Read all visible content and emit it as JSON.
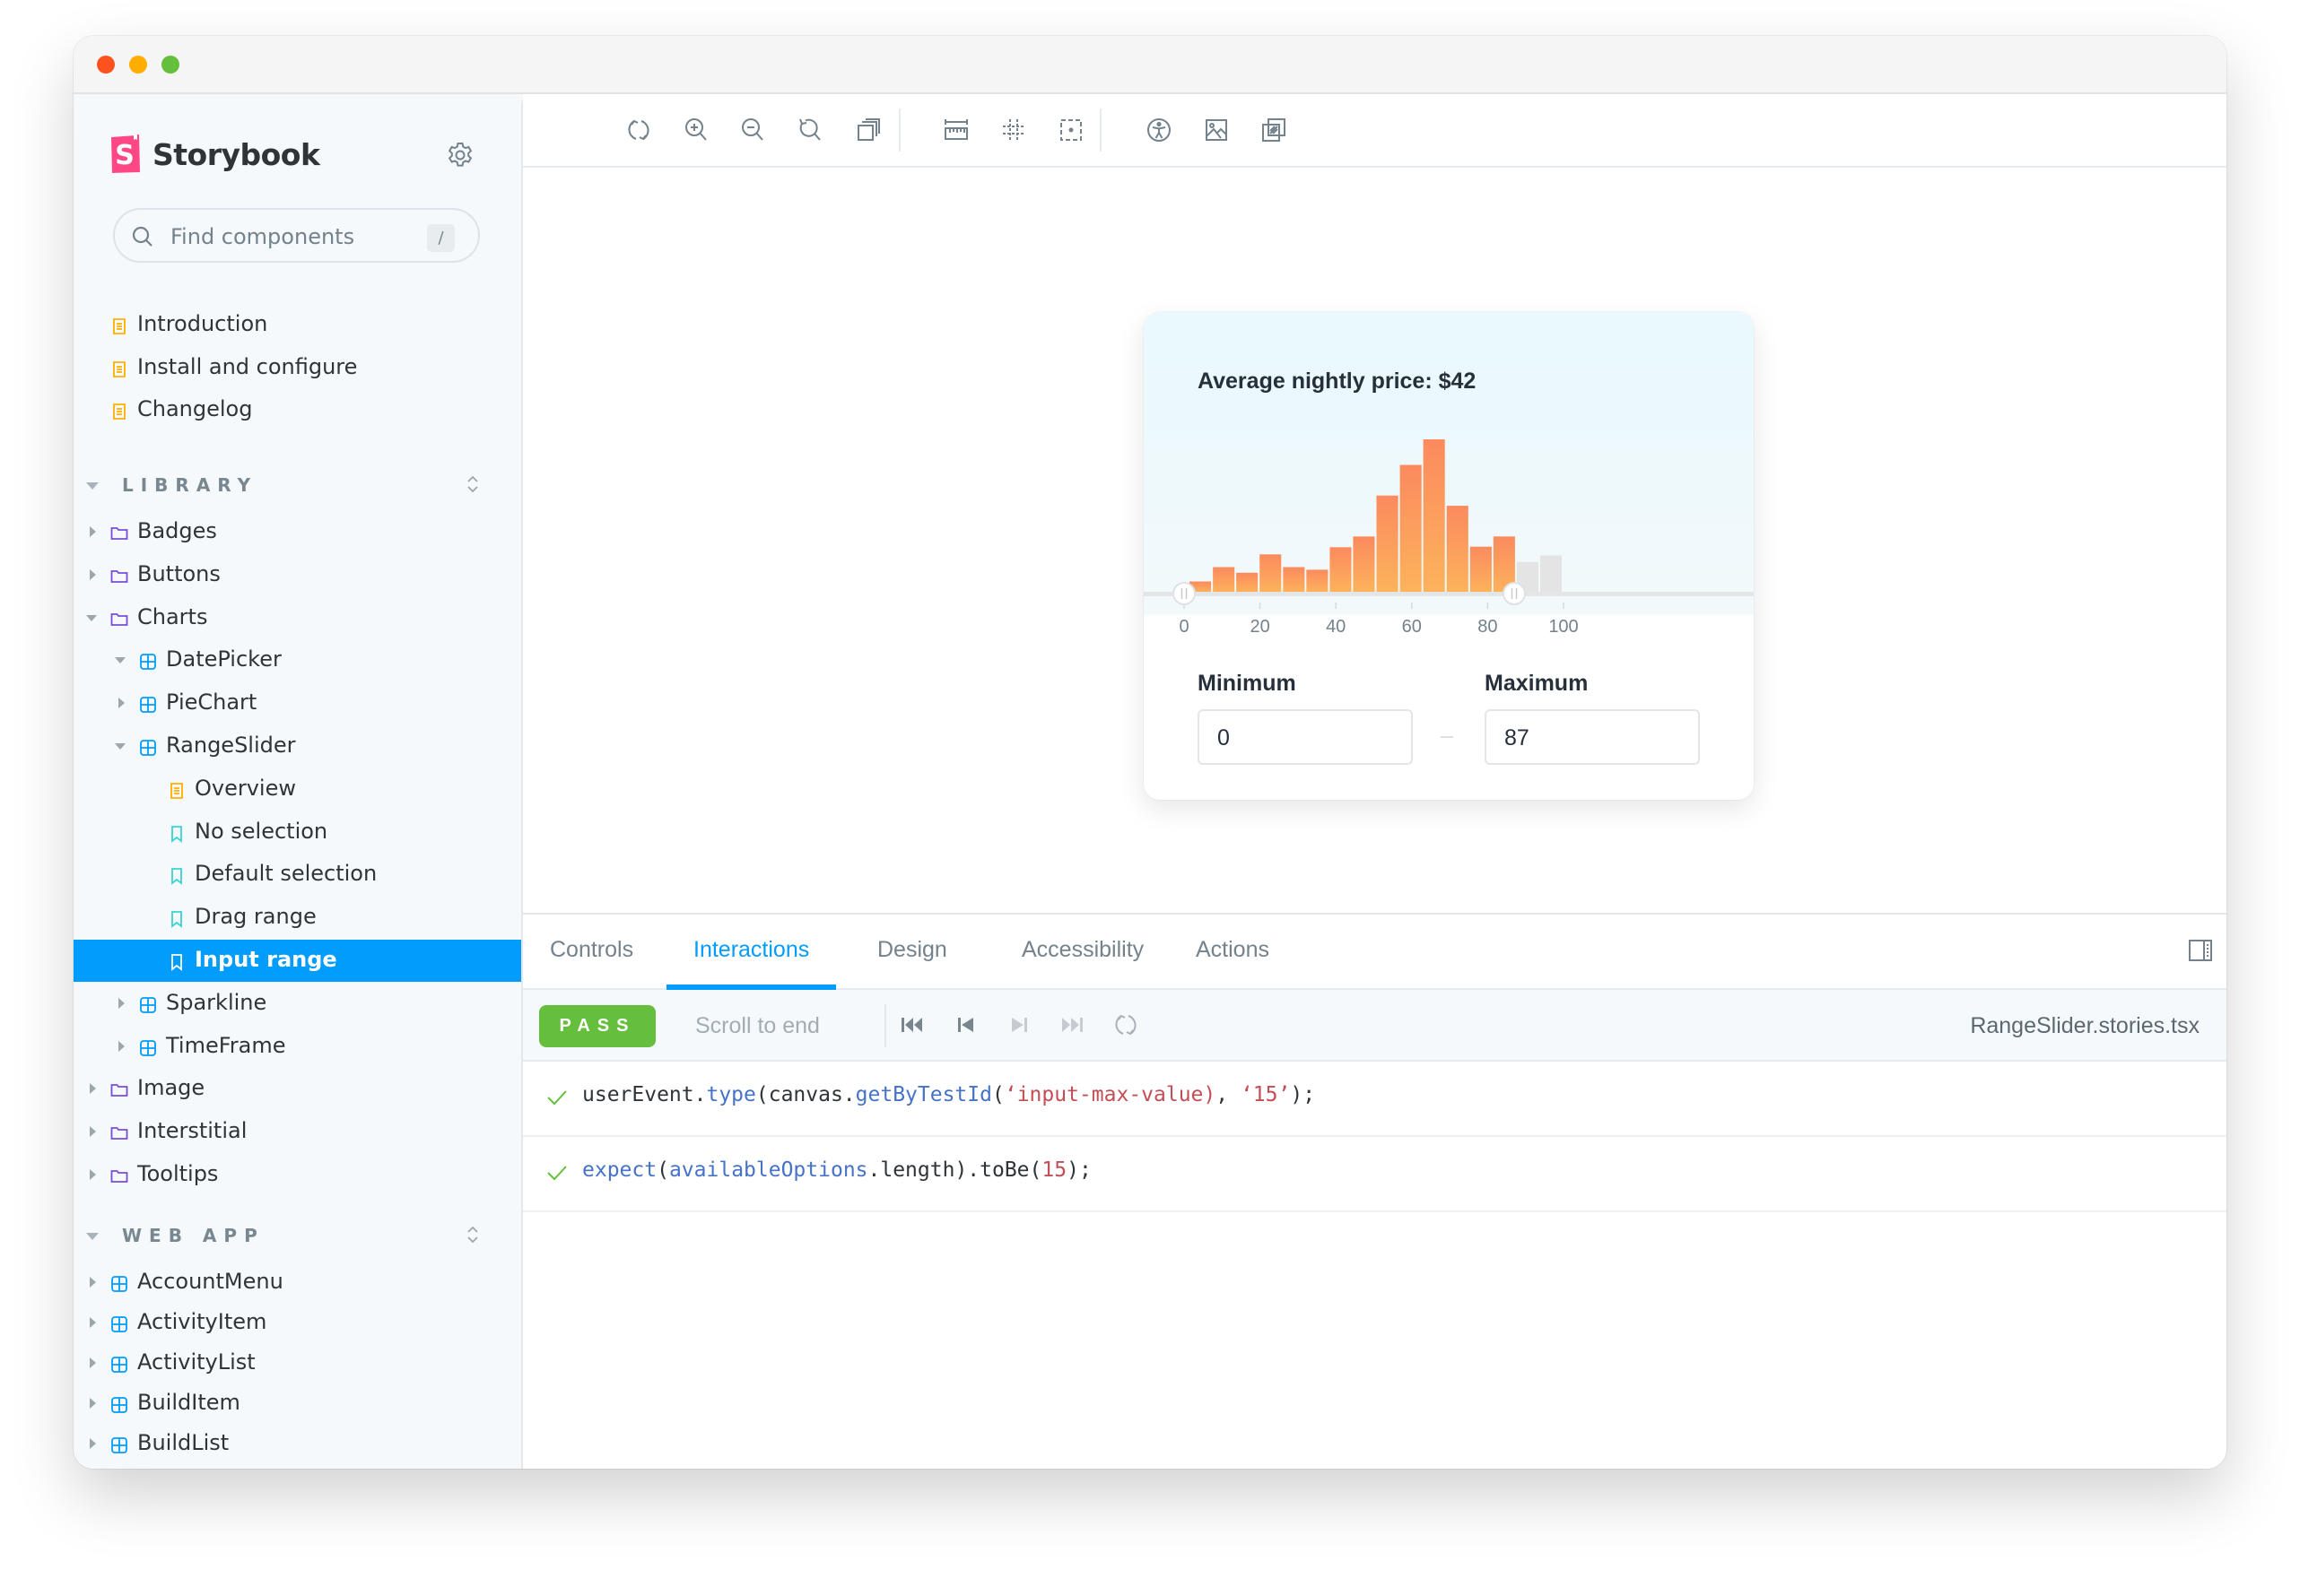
{
  "window": {
    "traffic_lights": [
      "close",
      "minimize",
      "zoom"
    ]
  },
  "sidebar": {
    "brand": "Storybook",
    "search": {
      "placeholder": "Find components",
      "shortcut": "/"
    },
    "top_items": [
      {
        "label": "Introduction",
        "icon": "document-icon"
      },
      {
        "label": "Install and configure",
        "icon": "document-icon"
      },
      {
        "label": "Changelog",
        "icon": "document-icon"
      }
    ],
    "sections": [
      {
        "title": "LIBRARY",
        "items": [
          {
            "label": "Badges",
            "icon": "folder-icon",
            "depth": 0,
            "expanded": false
          },
          {
            "label": "Buttons",
            "icon": "folder-icon",
            "depth": 0,
            "expanded": false
          },
          {
            "label": "Charts",
            "icon": "folder-icon",
            "depth": 0,
            "expanded": true
          },
          {
            "label": "DatePicker",
            "icon": "component-icon",
            "depth": 1,
            "expanded": true
          },
          {
            "label": "PieChart",
            "icon": "component-icon",
            "depth": 1,
            "expanded": false
          },
          {
            "label": "RangeSlider",
            "icon": "component-icon",
            "depth": 1,
            "expanded": true
          },
          {
            "label": "Overview",
            "icon": "document-icon",
            "depth": 2
          },
          {
            "label": "No selection",
            "icon": "bookmark-icon",
            "depth": 2
          },
          {
            "label": "Default selection",
            "icon": "bookmark-icon",
            "depth": 2
          },
          {
            "label": "Drag range",
            "icon": "bookmark-icon",
            "depth": 2
          },
          {
            "label": "Input range",
            "icon": "bookmark-icon",
            "depth": 2,
            "selected": true
          },
          {
            "label": "Sparkline",
            "icon": "component-icon",
            "depth": 1,
            "expanded": false
          },
          {
            "label": "TimeFrame",
            "icon": "component-icon",
            "depth": 1,
            "expanded": false
          },
          {
            "label": "Image",
            "icon": "folder-icon",
            "depth": 0,
            "expanded": false
          },
          {
            "label": "Interstitial",
            "icon": "folder-icon",
            "depth": 0,
            "expanded": false
          },
          {
            "label": "Tooltips",
            "icon": "folder-icon",
            "depth": 0,
            "expanded": false
          }
        ]
      },
      {
        "title": "WEB APP",
        "items": [
          {
            "label": "AccountMenu",
            "icon": "component-icon",
            "depth": 0,
            "expanded": false
          },
          {
            "label": "ActivityItem",
            "icon": "component-icon",
            "depth": 0,
            "expanded": false
          },
          {
            "label": "ActivityList",
            "icon": "component-icon",
            "depth": 0,
            "expanded": false
          },
          {
            "label": "BuildItem",
            "icon": "component-icon",
            "depth": 0,
            "expanded": false
          },
          {
            "label": "BuildList",
            "icon": "component-icon",
            "depth": 0,
            "expanded": false
          }
        ]
      }
    ]
  },
  "toolbar": {
    "left_tools": [
      "reload-icon",
      "zoom-in-icon",
      "zoom-out-icon",
      "zoom-reset-icon",
      "background-icon",
      "measure-icon",
      "grid-icon",
      "outline-icon",
      "accessibility-icon",
      "image-icon",
      "transparency-icon"
    ],
    "right_tools": [
      "open-new-tab-icon"
    ]
  },
  "preview": {
    "card_title": "Average nightly price: $42",
    "minimum": {
      "label": "Minimum",
      "value": "0"
    },
    "maximum": {
      "label": "Maximum",
      "value": "87"
    },
    "separator": "–"
  },
  "chart_data": {
    "type": "bar",
    "title": "Average nightly price: $42",
    "xlabel": "",
    "ylabel": "",
    "x_ticks": [
      "0",
      "20",
      "40",
      "60",
      "80",
      "100"
    ],
    "xlim": [
      0,
      100
    ],
    "bins": 16,
    "values": [
      2.2,
      5,
      3.9,
      7.5,
      5,
      4.5,
      8.9,
      11,
      19,
      25,
      30,
      17,
      9,
      11,
      6,
      7.3
    ],
    "selected_range": [
      0,
      87
    ],
    "selected_color": "#fb8d5e",
    "selected_color_light": "#fdb35c",
    "unselected_color": "#e4e4e4",
    "grid": false
  },
  "panel": {
    "tabs": [
      {
        "label": "Controls",
        "active": false
      },
      {
        "label": "Interactions",
        "active": true
      },
      {
        "label": "Design",
        "active": false
      },
      {
        "label": "Accessibility",
        "active": false
      },
      {
        "label": "Actions",
        "active": false
      }
    ],
    "status": "PASS",
    "scroll_label": "Scroll to end",
    "file": "RangeSlider.stories.tsx",
    "steps": [
      {
        "status": "pass",
        "tokens": [
          {
            "t": "userEvent.",
            "c": "plain"
          },
          {
            "t": "type",
            "c": "fn"
          },
          {
            "t": "(canvas.",
            "c": "plain"
          },
          {
            "t": "getByTestId",
            "c": "fn"
          },
          {
            "t": "(",
            "c": "plain"
          },
          {
            "t": "‘input-max-value)",
            "c": "str"
          },
          {
            "t": ", ",
            "c": "plain"
          },
          {
            "t": "‘15’",
            "c": "str"
          },
          {
            "t": ");",
            "c": "plain"
          }
        ]
      },
      {
        "status": "pass",
        "tokens": [
          {
            "t": "expect",
            "c": "fn"
          },
          {
            "t": "(",
            "c": "plain"
          },
          {
            "t": "availableOptions",
            "c": "fn"
          },
          {
            "t": ".length).toBe(",
            "c": "plain"
          },
          {
            "t": "15",
            "c": "num"
          },
          {
            "t": ");",
            "c": "plain"
          }
        ]
      }
    ]
  },
  "colors": {
    "accent": "#029cfd",
    "pass": "#66bf3c",
    "brand": "#ff4785"
  }
}
